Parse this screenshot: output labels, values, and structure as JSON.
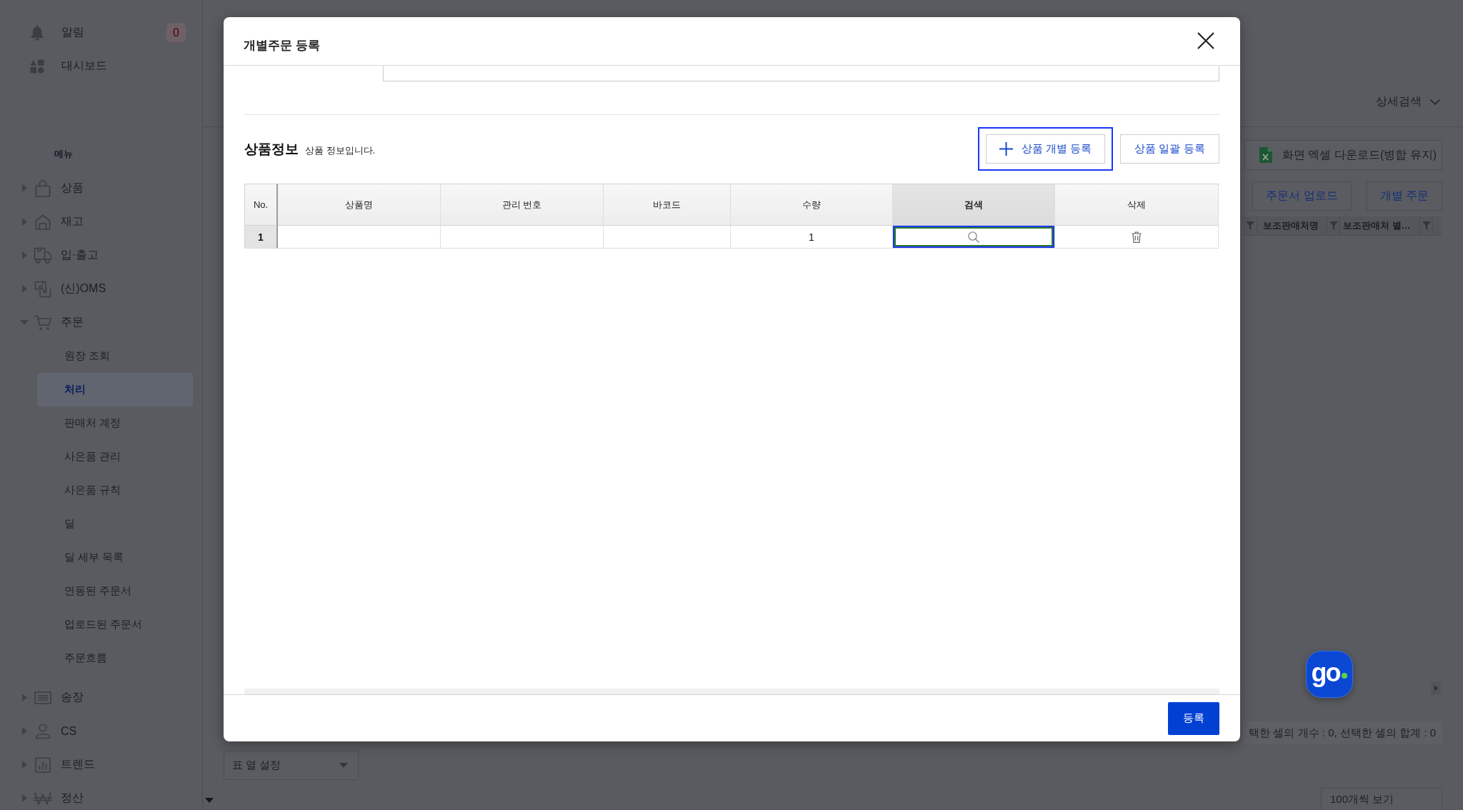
{
  "sidebar": {
    "top_items": [
      {
        "label": "알림",
        "badge": "0"
      },
      {
        "label": "대시보드"
      }
    ],
    "section_label": "메뉴",
    "menu": [
      {
        "label": "상품",
        "expanded": false
      },
      {
        "label": "재고",
        "expanded": false
      },
      {
        "label": "입·출고",
        "expanded": false
      },
      {
        "label": "(신)OMS",
        "expanded": false
      },
      {
        "label": "주문",
        "expanded": true,
        "children": [
          {
            "label": "원장 조회",
            "selected": false
          },
          {
            "label": "처리",
            "selected": true
          },
          {
            "label": "판매처 계정",
            "selected": false
          },
          {
            "label": "사은품 관리",
            "selected": false
          },
          {
            "label": "사은품 규칙",
            "selected": false
          },
          {
            "label": "딜",
            "selected": false
          },
          {
            "label": "딜 세부 목록",
            "selected": false
          },
          {
            "label": "연동된 주문서",
            "selected": false
          },
          {
            "label": "업로드된 주문서",
            "selected": false
          },
          {
            "label": "주문흐름",
            "selected": false
          }
        ]
      },
      {
        "label": "송장",
        "expanded": false
      },
      {
        "label": "CS",
        "expanded": false
      },
      {
        "label": "트렌드",
        "expanded": false
      },
      {
        "label": "정산",
        "expanded": false
      }
    ]
  },
  "page": {
    "detail_search": "상세검색",
    "excel_download": "화면 엑셀 다운로드(병합 유지)",
    "actions": [
      "주문서 업로드",
      "개별 주문"
    ],
    "grid_columns": [
      "보조판매처명",
      "보조판매처 별…"
    ],
    "selection_summary": "택한 셀의 개수 : 0, 선택한 셀의 합계 : 0",
    "column_settings": "표 열 설정",
    "page_size": "100개씩 보기"
  },
  "chat_button": {
    "label": "go"
  },
  "modal": {
    "title": "개별주문 등록",
    "section_title": "상품정보",
    "section_description": "상품 정보입니다.",
    "buttons": [
      {
        "label": "상품 개별 등록",
        "kind": "add",
        "focused": true
      },
      {
        "label": "상품 일괄 등록",
        "kind": "plain",
        "focused": false
      }
    ],
    "table": {
      "columns": [
        {
          "label": "No.",
          "kind": "index",
          "selected": false
        },
        {
          "label": "상품명",
          "kind": "text",
          "selected": false
        },
        {
          "label": "관리 번호",
          "kind": "text",
          "selected": false
        },
        {
          "label": "바코드",
          "kind": "text",
          "selected": false
        },
        {
          "label": "수량",
          "kind": "quantity",
          "selected": false
        },
        {
          "label": "검색",
          "kind": "search",
          "selected": true
        },
        {
          "label": "삭제",
          "kind": "delete",
          "selected": false
        }
      ],
      "rows": [
        {
          "no": "1",
          "quantity": "1"
        }
      ]
    },
    "submit": "등록"
  }
}
